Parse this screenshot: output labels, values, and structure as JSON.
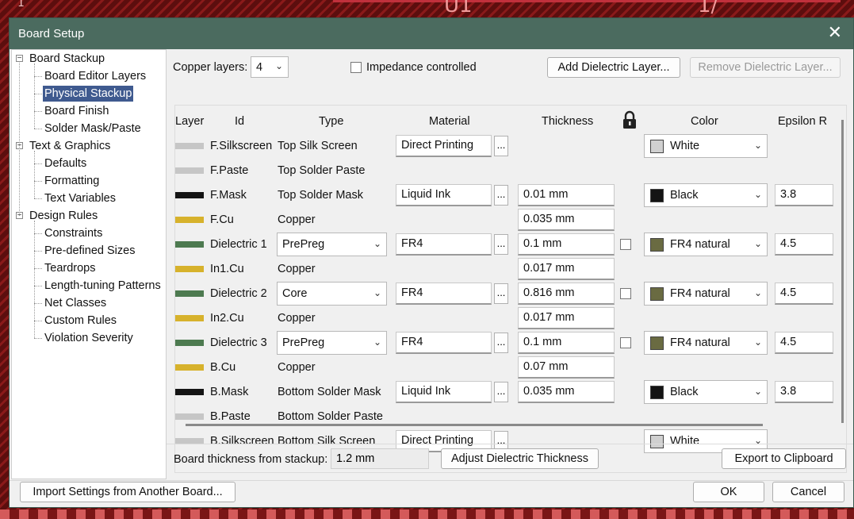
{
  "window": {
    "title": "Board Setup",
    "close_glyph": "✕"
  },
  "tree": {
    "sections": [
      {
        "label": "Board Stackup",
        "items": [
          "Board Editor Layers",
          "Physical Stackup",
          "Board Finish",
          "Solder Mask/Paste"
        ]
      },
      {
        "label": "Text & Graphics",
        "items": [
          "Defaults",
          "Formatting",
          "Text Variables"
        ]
      },
      {
        "label": "Design Rules",
        "items": [
          "Constraints",
          "Pre-defined Sizes",
          "Teardrops",
          "Length-tuning Patterns",
          "Net Classes",
          "Custom Rules",
          "Violation Severity"
        ]
      }
    ],
    "selected": "Physical Stackup",
    "toggle_glyph": "−"
  },
  "toolbar": {
    "copper_layers_label": "Copper layers:",
    "copper_layers_value": "4",
    "impedance_label": "Impedance controlled",
    "impedance_checked": false,
    "add_dielectric": "Add Dielectric Layer...",
    "remove_dielectric": "Remove Dielectric Layer..."
  },
  "table": {
    "headers": {
      "layer": "Layer",
      "id": "Id",
      "type": "Type",
      "material": "Material",
      "thickness": "Thickness",
      "lock": "lock-icon",
      "color": "Color",
      "epsilon": "Epsilon R"
    },
    "rows": [
      {
        "swatch": "#c6c6c6",
        "id": "F.Silkscreen",
        "type": "Top Silk Screen",
        "material": "Direct Printing",
        "thickness": "",
        "color": "White",
        "color_hex": "#d0d0d0",
        "epsilon": ""
      },
      {
        "swatch": "#c6c6c6",
        "id": "F.Paste",
        "type": "Top Solder Paste",
        "material": "",
        "thickness": "",
        "color": "",
        "color_hex": "",
        "epsilon": ""
      },
      {
        "swatch": "#141414",
        "id": "F.Mask",
        "type": "Top Solder Mask",
        "material": "Liquid Ink",
        "thickness": "0.01 mm",
        "color": "Black",
        "color_hex": "#141414",
        "epsilon": "3.8"
      },
      {
        "swatch": "#d7b22c",
        "id": "F.Cu",
        "type": "Copper",
        "material": "",
        "thickness": "0.035 mm",
        "color": "",
        "color_hex": "",
        "epsilon": ""
      },
      {
        "swatch": "#4d7a50",
        "id": "Dielectric 1",
        "type": "PrePreg",
        "type_combo": true,
        "material": "FR4",
        "thickness": "0.1 mm",
        "lock": true,
        "color": "FR4 natural",
        "color_hex": "#6a6b42",
        "epsilon": "4.5"
      },
      {
        "swatch": "#d7b22c",
        "id": "In1.Cu",
        "type": "Copper",
        "material": "",
        "thickness": "0.017 mm",
        "color": "",
        "color_hex": "",
        "epsilon": ""
      },
      {
        "swatch": "#4d7a50",
        "id": "Dielectric 2",
        "type": "Core",
        "type_combo": true,
        "material": "FR4",
        "thickness": "0.816 mm",
        "lock": true,
        "color": "FR4 natural",
        "color_hex": "#6a6b42",
        "epsilon": "4.5"
      },
      {
        "swatch": "#d7b22c",
        "id": "In2.Cu",
        "type": "Copper",
        "material": "",
        "thickness": "0.017 mm",
        "color": "",
        "color_hex": "",
        "epsilon": ""
      },
      {
        "swatch": "#4d7a50",
        "id": "Dielectric 3",
        "type": "PrePreg",
        "type_combo": true,
        "material": "FR4",
        "thickness": "0.1 mm",
        "lock": true,
        "color": "FR4 natural",
        "color_hex": "#6a6b42",
        "epsilon": "4.5"
      },
      {
        "swatch": "#d7b22c",
        "id": "B.Cu",
        "type": "Copper",
        "material": "",
        "thickness": "0.07 mm",
        "color": "",
        "color_hex": "",
        "epsilon": ""
      },
      {
        "swatch": "#141414",
        "id": "B.Mask",
        "type": "Bottom Solder Mask",
        "material": "Liquid Ink",
        "thickness": "0.035 mm",
        "color": "Black",
        "color_hex": "#141414",
        "epsilon": "3.8"
      },
      {
        "swatch": "#c6c6c6",
        "id": "B.Paste",
        "type": "Bottom Solder Paste",
        "material": "",
        "thickness": "",
        "color": "",
        "color_hex": "",
        "epsilon": ""
      },
      {
        "swatch": "#c6c6c6",
        "id": "B.Silkscreen",
        "type": "Bottom Silk Screen",
        "material": "Direct Printing",
        "thickness": "",
        "color": "White",
        "color_hex": "#d0d0d0",
        "epsilon": ""
      }
    ],
    "ellipsis": "...",
    "chevron": "⌄"
  },
  "footer": {
    "board_thickness_label": "Board thickness from stackup:",
    "board_thickness_value": "1.2 mm",
    "adjust_button": "Adjust Dielectric Thickness",
    "export_button": "Export to Clipboard",
    "import_button": "Import Settings from Another Board...",
    "ok_button": "OK",
    "cancel_button": "Cancel"
  },
  "background": {
    "letters": [
      "1",
      "U1",
      "1/"
    ]
  }
}
